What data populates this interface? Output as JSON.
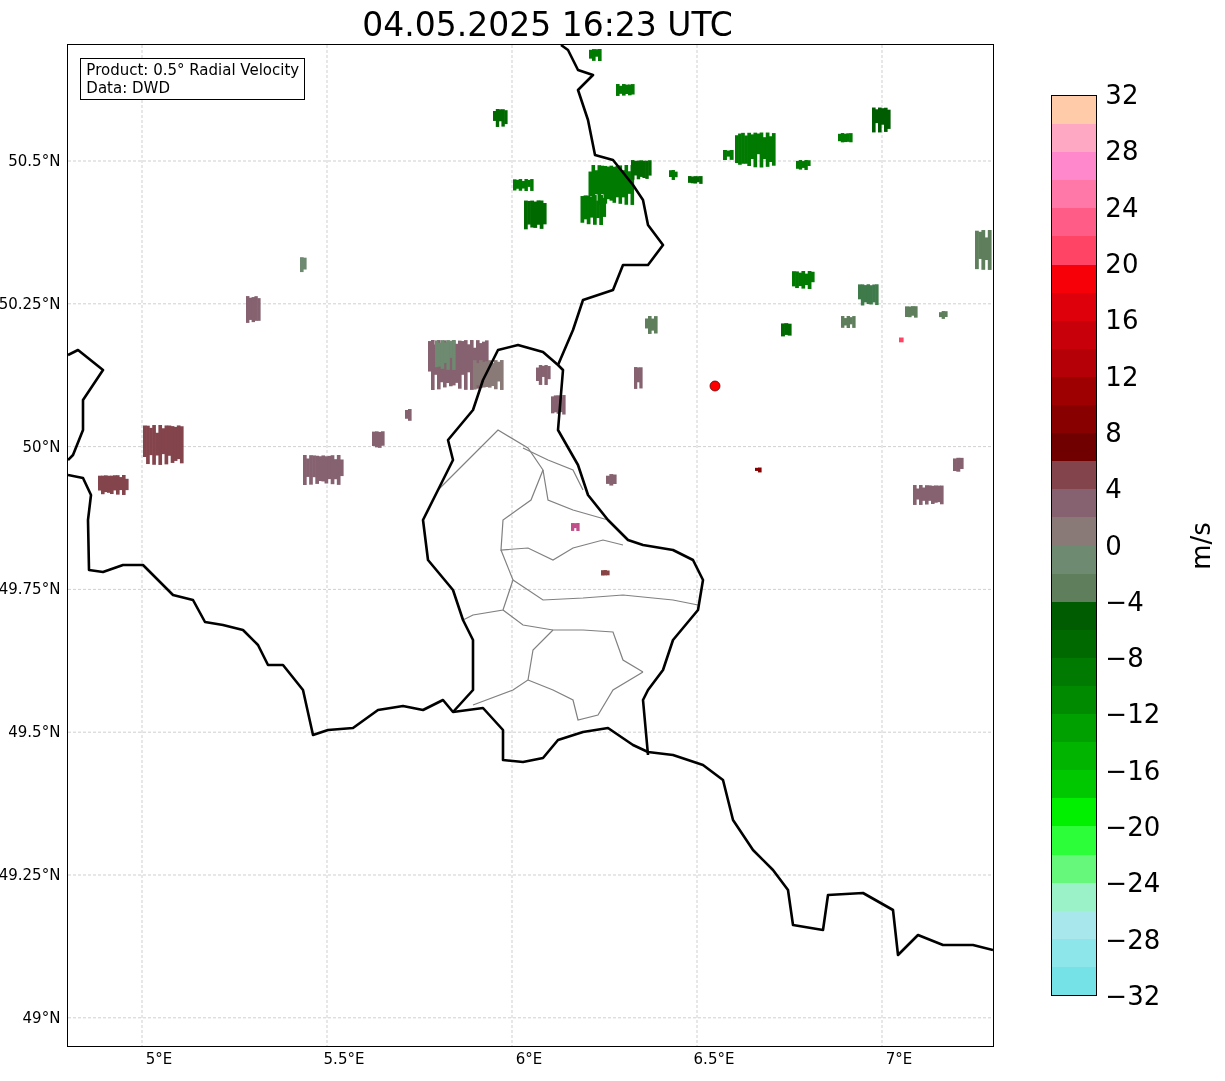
{
  "title": "04.05.2025 16:23 UTC",
  "info_box": {
    "lines": [
      "Product: 0.5° Radial Velocity",
      "Data: DWD"
    ]
  },
  "lat_ticks": [
    "50.5°N",
    "50.25°N",
    "50°N",
    "49.75°N",
    "49.5°N",
    "49.25°N",
    "49°N"
  ],
  "lon_ticks": [
    "5°E",
    "5.5°E",
    "6°E",
    "6.5°E",
    "7°E"
  ],
  "colorbar": {
    "label": "m/s",
    "ticks": [
      "32",
      "28",
      "24",
      "20",
      "16",
      "12",
      "8",
      "4",
      "0",
      "−4",
      "−8",
      "−12",
      "−16",
      "−20",
      "−24",
      "−28",
      "−32"
    ],
    "bins": [
      {
        "color": "#ffcba8"
      },
      {
        "color": "#ffa8c4"
      },
      {
        "color": "#ff88cc"
      },
      {
        "color": "#ff78a8"
      },
      {
        "color": "#ff5c88"
      },
      {
        "color": "#ff4466"
      },
      {
        "color": "#f70008"
      },
      {
        "color": "#de000a"
      },
      {
        "color": "#c8000a"
      },
      {
        "color": "#b40006"
      },
      {
        "color": "#9e0002"
      },
      {
        "color": "#880000"
      },
      {
        "color": "#700000"
      },
      {
        "color": "#84444c"
      },
      {
        "color": "#866270"
      },
      {
        "color": "#897a78"
      },
      {
        "color": "#6e8a70"
      },
      {
        "color": "#5f7f5c"
      },
      {
        "color": "#005c00"
      },
      {
        "color": "#006a00"
      },
      {
        "color": "#007a00"
      },
      {
        "color": "#008a00"
      },
      {
        "color": "#00a000"
      },
      {
        "color": "#00b400"
      },
      {
        "color": "#00c800"
      },
      {
        "color": "#00f000"
      },
      {
        "color": "#2cff3a"
      },
      {
        "color": "#66f87a"
      },
      {
        "color": "#9cf2c8"
      },
      {
        "color": "#a8e8ec"
      },
      {
        "color": "#8ce6ea"
      },
      {
        "color": "#74e2e6"
      }
    ]
  }
}
